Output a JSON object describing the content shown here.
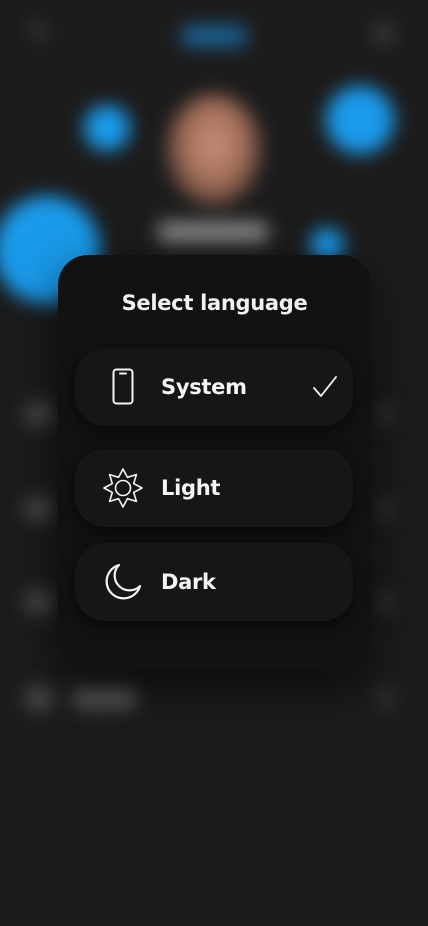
{
  "modal": {
    "title": "Select language",
    "options": [
      {
        "label": "System",
        "icon": "smartphone-icon",
        "selected": true
      },
      {
        "label": "Light",
        "icon": "sun-icon",
        "selected": false
      },
      {
        "label": "Dark",
        "icon": "moon-icon",
        "selected": false
      }
    ]
  },
  "colors": {
    "background": "#1c1c1c",
    "modal": "#121212",
    "accent": "#1a9aea",
    "text": "#f4f4f4"
  }
}
